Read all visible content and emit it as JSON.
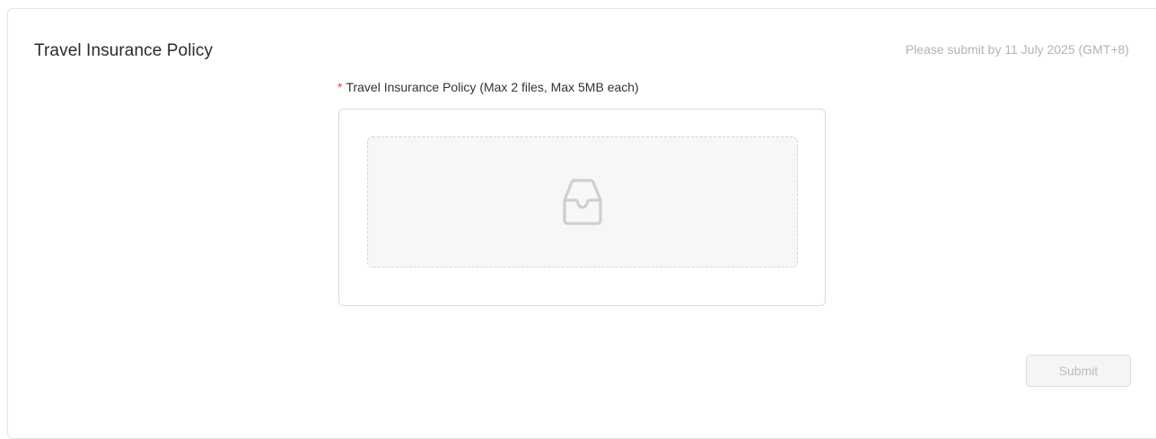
{
  "section": {
    "title": "Travel Insurance Policy",
    "deadline": "Please submit by 11 July 2025 (GMT+8)"
  },
  "upload": {
    "required_marker": "*",
    "label": "Travel Insurance Policy (Max 2 files, Max 5MB each)",
    "icon": "inbox-icon"
  },
  "actions": {
    "submit_label": "Submit"
  },
  "colors": {
    "required": "#e0433a",
    "muted_text": "#b3b3b3",
    "border": "#dcdcdc"
  }
}
